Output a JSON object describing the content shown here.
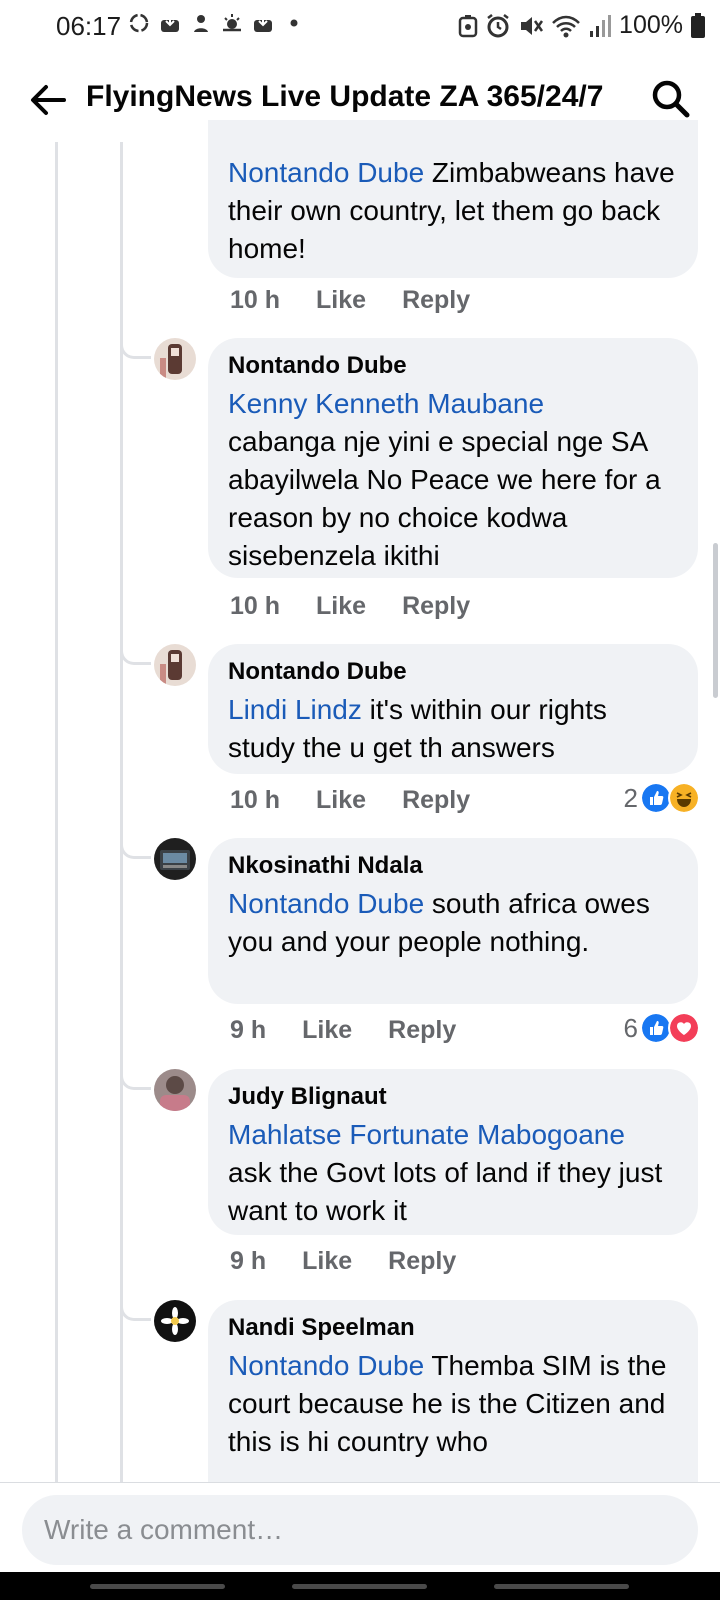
{
  "status": {
    "time": "06:17",
    "battery": "100%"
  },
  "header": {
    "title": "FlyingNews Live Update ZA 365/24/7"
  },
  "comments": [
    {
      "author": "",
      "mention": "Nontando Dube",
      "text": " Zimbabweans have their own country, let them go back home!",
      "time": "10 h",
      "like": "Like",
      "reply": "Reply",
      "reaction_count": ""
    },
    {
      "author": "Nontando Dube",
      "mention": "Kenny Kenneth Maubane",
      "text": "cabanga nje yini e special nge SA abayilwela No Peace we here for a reason by no choice kodwa sisebenzela ikithi",
      "time": "10 h",
      "like": "Like",
      "reply": "Reply",
      "reaction_count": ""
    },
    {
      "author": "Nontando Dube",
      "mention": "Lindi Lindz",
      "text": " it's within our rights study the u get th answers",
      "time": "10 h",
      "like": "Like",
      "reply": "Reply",
      "reaction_count": "2",
      "reactions": [
        "like-icon",
        "haha-icon"
      ]
    },
    {
      "author": "Nkosinathi Ndala",
      "mention": "Nontando Dube",
      "text": " south africa owes you and your people nothing.",
      "time": "9 h",
      "like": "Like",
      "reply": "Reply",
      "reaction_count": "6",
      "reactions": [
        "like-icon",
        "love-icon"
      ]
    },
    {
      "author": "Judy Blignaut",
      "mention": "Mahlatse Fortunate Mabogoane",
      "text": "ask the Govt lots of land if they just want to work it",
      "time": "9 h",
      "like": "Like",
      "reply": "Reply",
      "reaction_count": ""
    },
    {
      "author": "Nandi Speelman",
      "mention": "Nontando Dube",
      "text": " Themba SIM is the court because he is the Citizen and this is hi country who",
      "time": "",
      "like": "",
      "reply": "",
      "reaction_count": ""
    }
  ],
  "composer": {
    "placeholder": "Write a comment…"
  },
  "colors": {
    "mention": "#1a5bb8",
    "bubble": "#f0f2f5",
    "meta": "#65676b",
    "like_blue": "#1877f2",
    "love_red": "#f33e58",
    "haha_yellow": "#f7b125"
  }
}
